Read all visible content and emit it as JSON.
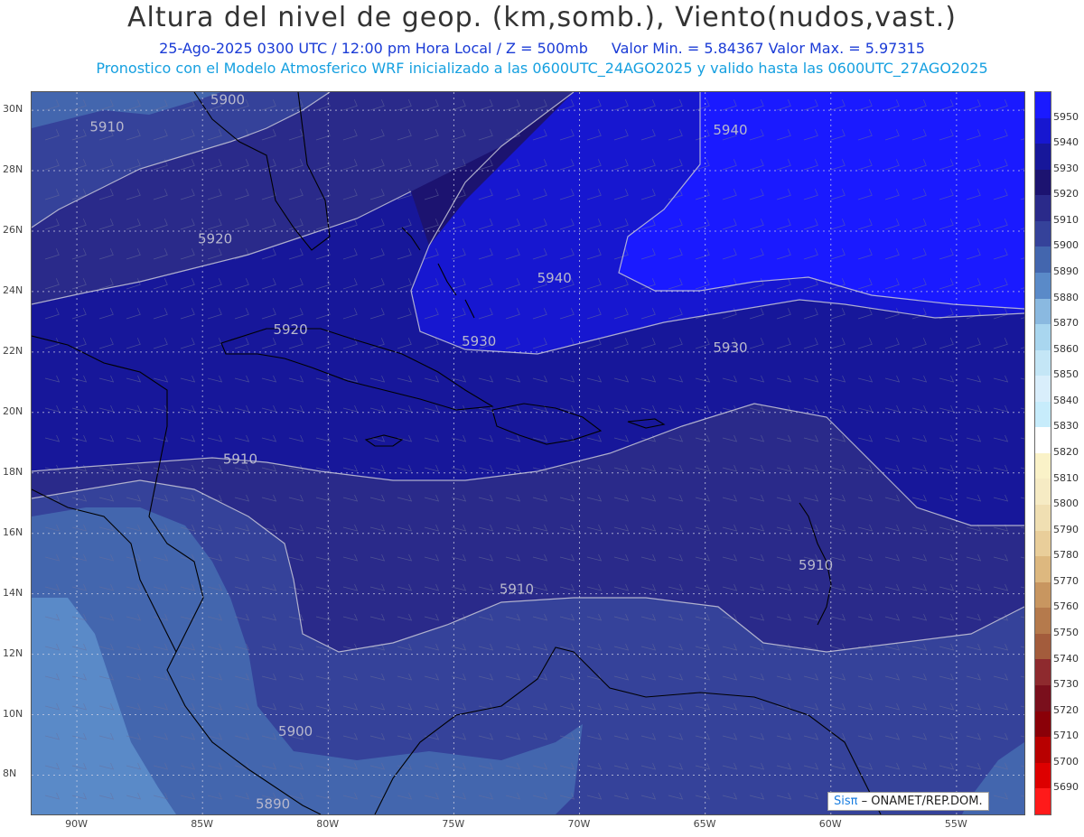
{
  "header": {
    "title": "Altura del nivel de geop. (km,somb.), Viento(nudos,vast.)",
    "line1_a": "25-Ago-2025 0300 UTC / 12:00 pm Hora Local / Z = 500mb",
    "line1_b": "Valor Min. = 5.84367  Valor Max. = 5.97315",
    "line2": "Pronostico con el Modelo Atmosferico WRF inicializado a las 0600UTC_24AGO2025 y valido hasta las  0600UTC_27AGO2025"
  },
  "map": {
    "lon_labels": [
      "90W",
      "85W",
      "80W",
      "75W",
      "70W",
      "65W",
      "60W",
      "55W"
    ],
    "lon_values": [
      -90,
      -85,
      -80,
      -75,
      -70,
      -65,
      -60,
      -55
    ],
    "lat_labels": [
      "30N",
      "28N",
      "26N",
      "24N",
      "22N",
      "20N",
      "18N",
      "16N",
      "14N",
      "12N",
      "10N",
      "8N"
    ],
    "lat_values": [
      30,
      28,
      26,
      24,
      22,
      20,
      18,
      16,
      14,
      12,
      10,
      8
    ],
    "lon_range": [
      -91.8,
      -52.3
    ],
    "lat_range": [
      6.7,
      30.6
    ],
    "contour_labels": [
      {
        "text": "5900",
        "lon": -84.0,
        "lat": 30.2
      },
      {
        "text": "5910",
        "lon": -88.8,
        "lat": 29.3
      },
      {
        "text": "5920",
        "lon": -84.5,
        "lat": 25.6
      },
      {
        "text": "5940",
        "lon": -64.0,
        "lat": 29.2
      },
      {
        "text": "5940",
        "lon": -71.0,
        "lat": 24.3
      },
      {
        "text": "5920",
        "lon": -81.5,
        "lat": 22.6
      },
      {
        "text": "5930",
        "lon": -74.0,
        "lat": 22.2
      },
      {
        "text": "5930",
        "lon": -64.0,
        "lat": 22.0
      },
      {
        "text": "5910",
        "lon": -83.5,
        "lat": 18.3
      },
      {
        "text": "5910",
        "lon": -60.6,
        "lat": 14.8
      },
      {
        "text": "5910",
        "lon": -72.5,
        "lat": 14.0
      },
      {
        "text": "5900",
        "lon": -81.3,
        "lat": 9.3
      },
      {
        "text": "5890",
        "lon": -82.2,
        "lat": 6.9
      }
    ]
  },
  "colorbar": {
    "levels": [
      "5950",
      "5940",
      "5930",
      "5920",
      "5910",
      "5900",
      "5890",
      "5880",
      "5870",
      "5860",
      "5850",
      "5840",
      "5830",
      "5820",
      "5810",
      "5800",
      "5790",
      "5780",
      "5770",
      "5760",
      "5750",
      "5740",
      "5730",
      "5720",
      "5710",
      "5700",
      "5690"
    ],
    "colors": [
      "#1a1aff",
      "#1717d0",
      "#17179a",
      "#1c1370",
      "#2a2a8a",
      "#35429a",
      "#4366ae",
      "#5a8ac8",
      "#8ab9e0",
      "#a9d6ef",
      "#c4e6f6",
      "#d9eefb",
      "#c7ecfb",
      "#ffffff",
      "#faf2c8",
      "#f6ebc4",
      "#f0dfb2",
      "#e9ce9a",
      "#ddb87f",
      "#c89660",
      "#b57a4c",
      "#a35c3c",
      "#8e2a2e",
      "#7a0f1c",
      "#8a0008",
      "#b80000",
      "#dd0000",
      "#ff1a1a"
    ]
  },
  "credit": {
    "brand": "Sisπ",
    "text": " – ONAMET/REP.DOM."
  }
}
